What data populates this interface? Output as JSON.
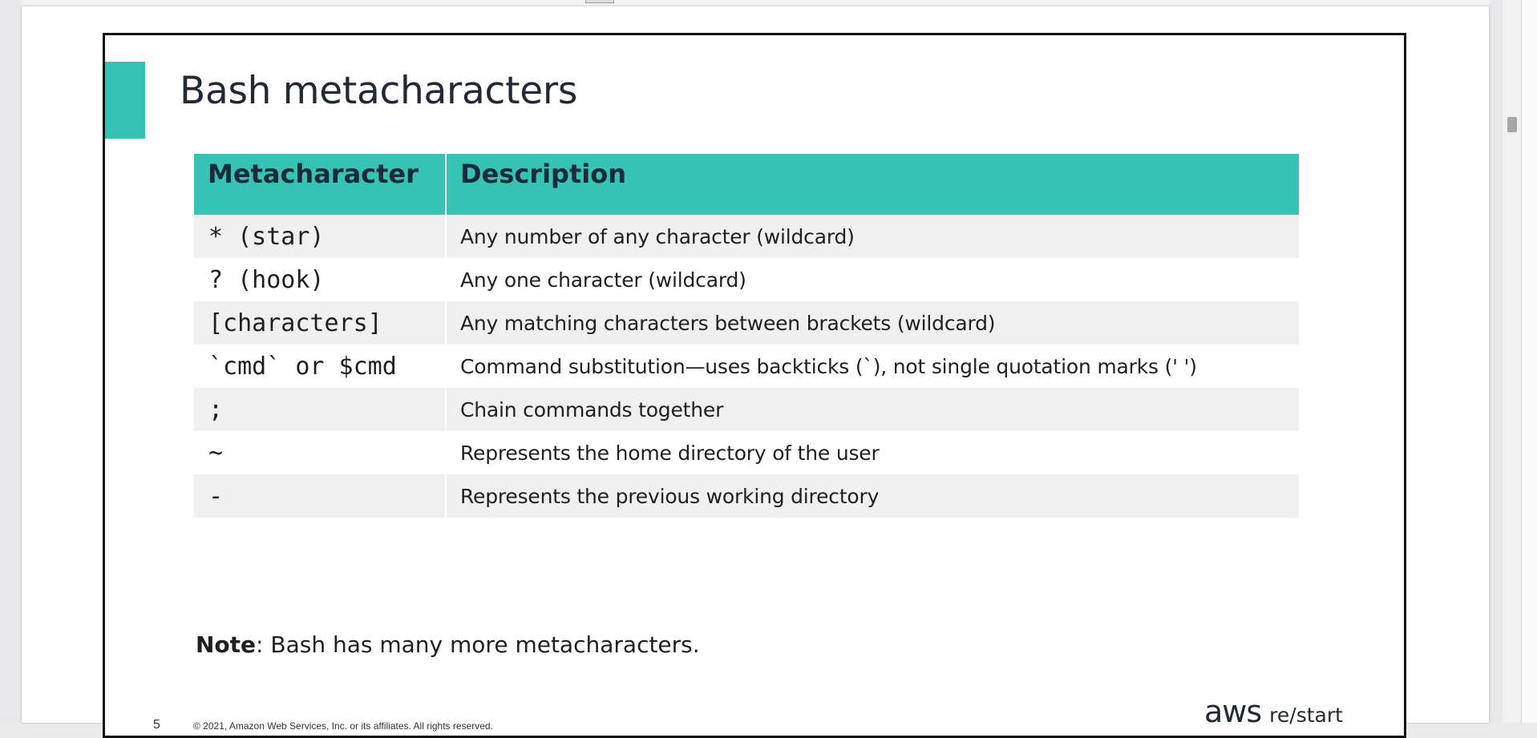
{
  "slide": {
    "title": "Bash metacharacters",
    "table": {
      "headers": [
        "Metacharacter",
        "Description"
      ],
      "rows": [
        {
          "metachar": "* (star)",
          "description": "Any number of any character (wildcard)"
        },
        {
          "metachar": "? (hook)",
          "description": "Any one character (wildcard)"
        },
        {
          "metachar": "[characters]",
          "description": "Any matching characters between brackets (wildcard)"
        },
        {
          "metachar": "`cmd` or $cmd",
          "description": "Command substitution—uses backticks (`), not single quotation marks (' ')"
        },
        {
          "metachar": ";",
          "description": "Chain commands together"
        },
        {
          "metachar": "~",
          "description": "Represents the home directory of the user"
        },
        {
          "metachar": "-",
          "description": "Represents the previous working directory"
        }
      ]
    },
    "note": {
      "label": "Note",
      "text": ": Bash has many more metacharacters."
    },
    "footer": {
      "page_number": "5",
      "copyright": "© 2021, Amazon Web Services, Inc. or its affiliates. All rights reserved."
    },
    "brand": {
      "logo_text": "aws",
      "product": "re/start"
    }
  },
  "colors": {
    "accent": "#36c2b4",
    "row_alt": "#f0f0f0",
    "title": "#1f2a36"
  }
}
